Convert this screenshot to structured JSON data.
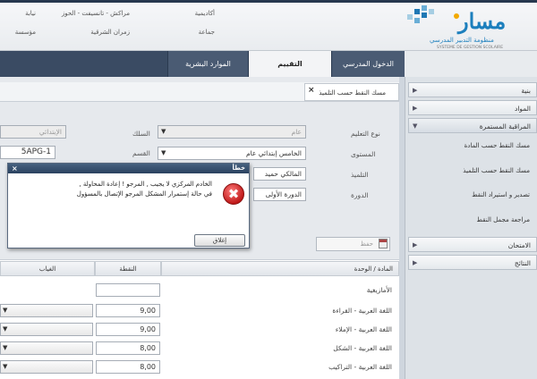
{
  "header": {
    "info": [
      {
        "label": "أكاديمية",
        "value": "مراكش - تانسيفت - الحوز"
      },
      {
        "label": "جماعة",
        "value": "زمران الشرقية"
      },
      {
        "label": "نيابة",
        "value": ""
      },
      {
        "label": "مؤسسة",
        "value": ""
      }
    ],
    "logo_text": "مسار",
    "logo_subtitle": "منظومة التدبير المدرسي",
    "logo_subtitle_fr": "SYSTEME DE GESTION SCOLAIRE"
  },
  "nav": {
    "tabs": [
      {
        "label": "الدخول المدرسي",
        "active": false
      },
      {
        "label": "التقييم",
        "active": true
      },
      {
        "label": "الموارد البشرية",
        "active": false
      }
    ]
  },
  "sidebar": {
    "items": [
      {
        "label": "بنية",
        "arrow": "▶",
        "open": false
      },
      {
        "label": "المواد",
        "arrow": "▶",
        "open": false
      },
      {
        "label": "المراقبة المستمرة",
        "arrow": "▼",
        "open": true
      },
      {
        "label": "الامتحان",
        "arrow": "▶",
        "open": false
      },
      {
        "label": "النتائج",
        "arrow": "▶",
        "open": false
      }
    ],
    "subitems": [
      "مسك النقط حسب المادة",
      "مسك النقط حسب التلميذ",
      "تصدير و استيراد النقط",
      "مراجعة مجمل النقط"
    ]
  },
  "content": {
    "tab_label": "مسك النقط حسب التلميذ",
    "form": {
      "type_label": "نوع التعليم",
      "type_value": "عام",
      "cycle_label": "السلك",
      "cycle_value": "الإبتدائي",
      "level_label": "المستوى",
      "level_value": "الخامس إبتدائي عام",
      "section_label": "القسم",
      "section_value": "5APG-1",
      "student_label": "التلميذ",
      "student_value": "المالكي حميد",
      "session_label": "الدورة",
      "session_value": "الدورة الأولى"
    },
    "date_placeholder": "حفظ",
    "table": {
      "headers": [
        "المادة / الوحدة",
        "النقطة",
        "الغياب"
      ],
      "rows": [
        {
          "subject": "الأمازيغية",
          "grade": ""
        },
        {
          "subject": "اللغة العربية - القراءة",
          "grade": "9,00"
        },
        {
          "subject": "اللغة العربية - الإملاء",
          "grade": "9,00"
        },
        {
          "subject": "اللغة العربية - الشكل",
          "grade": "8,00"
        },
        {
          "subject": "اللغة العربية - التراكيب",
          "grade": "8,00"
        }
      ]
    }
  },
  "dialog": {
    "title": "خطأ",
    "close_glyph": "×",
    "message_line1": "الخادم المركزي لا يجيب , المرجو ! إعادة المحاولة ,",
    "message_line2": "في حالة إستمرار المشكل المرجو الإتصال بالمسؤول",
    "button_label": "إغلاق"
  }
}
